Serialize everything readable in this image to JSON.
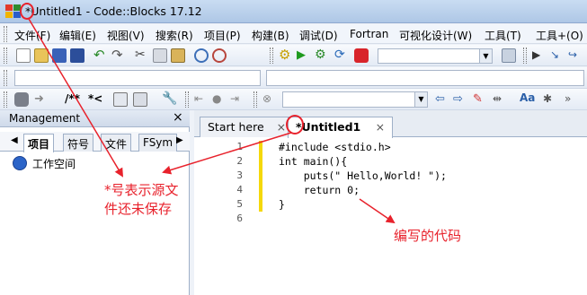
{
  "window": {
    "title": "*Untitled1 - Code::Blocks 17.12"
  },
  "menu": [
    "文件(F)",
    "编辑(E)",
    "视图(V)",
    "搜索(R)",
    "项目(P)",
    "构建(B)",
    "调试(D)",
    "Fortran",
    "可视化设计(W)",
    "工具(T)",
    "工具+(O)"
  ],
  "toolbar": {
    "comment_label": "/**",
    "stream_label": "*<",
    "aa_label": "Aa"
  },
  "management": {
    "title": "Management",
    "close": "×",
    "tabs": [
      "项目",
      "符号",
      "文件",
      "FSym"
    ],
    "tree_root": "工作空间"
  },
  "editor": {
    "tabs": [
      {
        "label": "Start here",
        "close": "×"
      },
      {
        "label": "*Untitled1",
        "close": "×"
      }
    ],
    "line_numbers": [
      "1",
      "2",
      "3",
      "4",
      "5",
      "6"
    ],
    "code_lines": [
      "#include <stdio.h>",
      "int main(){",
      "    puts(\" Hello,World! \");",
      "    return 0;",
      "}",
      ""
    ]
  },
  "annotations": {
    "unsaved_note_line1": "*号表示源文",
    "unsaved_note_line2": "件还未保存",
    "code_note": "编写的代码"
  },
  "colors": {
    "annotation": "#e8222c",
    "change_bar": "#f5d80a"
  }
}
